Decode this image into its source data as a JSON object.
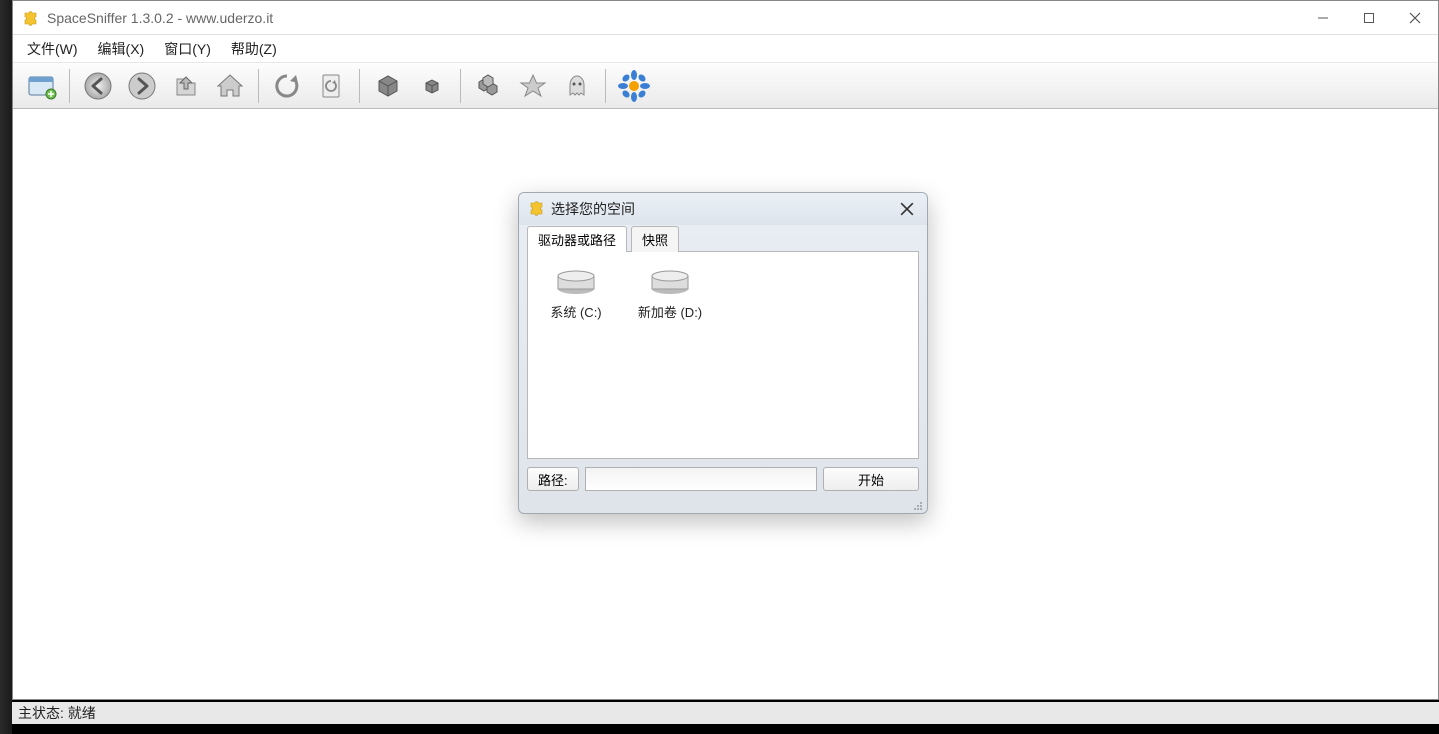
{
  "titlebar": {
    "title": "SpaceSniffer 1.3.0.2 - www.uderzo.it"
  },
  "menu": {
    "file": "文件(W)",
    "edit": "编辑(X)",
    "window": "窗口(Y)",
    "help": "帮助(Z)"
  },
  "toolbar_icons": {
    "new": "new-view",
    "back": "back",
    "forward": "forward",
    "up": "go-up",
    "home": "home",
    "refresh": "refresh",
    "reload": "reload-page",
    "box1": "large-blocks",
    "box2": "small-blocks",
    "tag": "tag-filter",
    "star": "favorites",
    "ghost": "ghost-files",
    "flower": "about"
  },
  "dialog": {
    "title": "选择您的空间",
    "tabs": {
      "drives": "驱动器或路径",
      "snapshot": "快照"
    },
    "drives": [
      {
        "label": "系统 (C:)"
      },
      {
        "label": "新加卷 (D:)"
      }
    ],
    "path_label": "路径:",
    "path_value": "",
    "start": "开始"
  },
  "status": {
    "label": "主状态:",
    "value": "就绪"
  }
}
